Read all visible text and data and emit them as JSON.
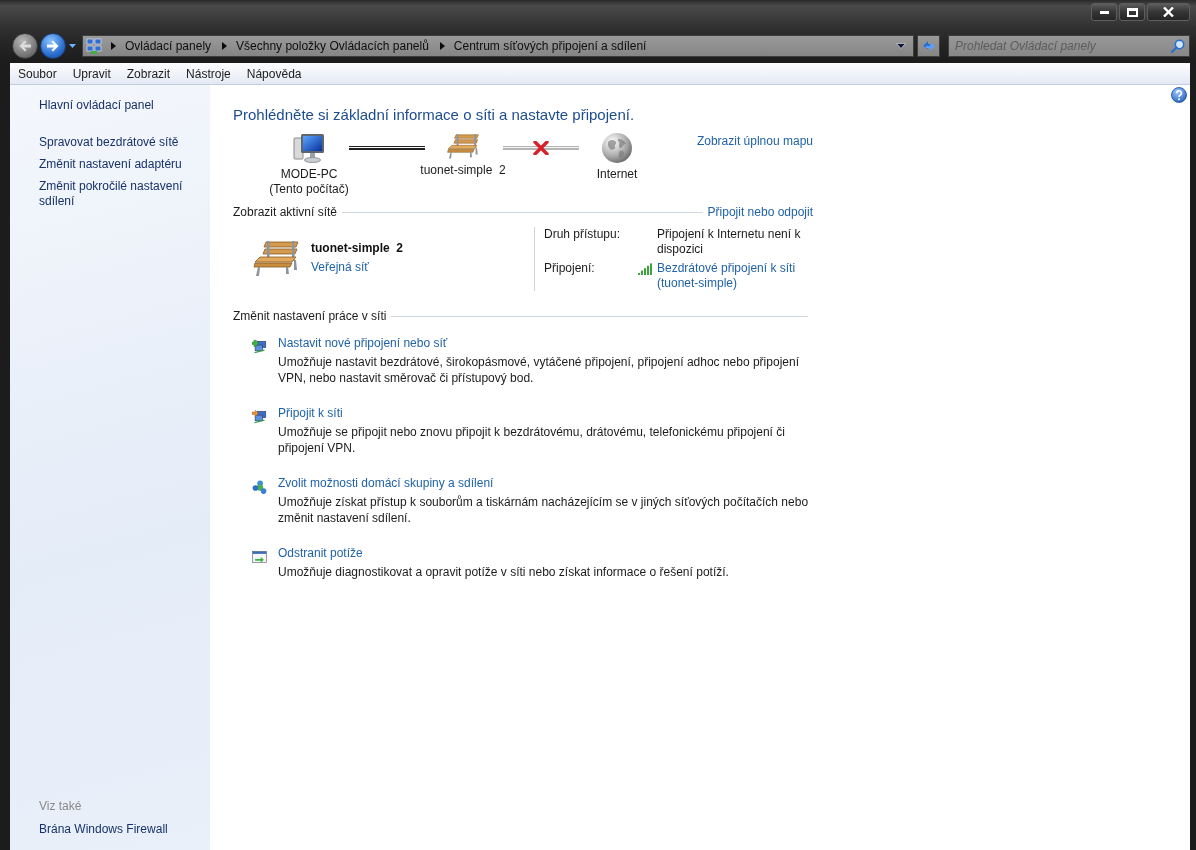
{
  "address_bar": {
    "path": [
      "Ovládací panely",
      "Všechny položky Ovládacích panelů",
      "Centrum síťových připojení a sdílení"
    ]
  },
  "search": {
    "placeholder": "Prohledat Ovládací panely"
  },
  "menu_bar": [
    "Soubor",
    "Upravit",
    "Zobrazit",
    "Nástroje",
    "Nápověda"
  ],
  "sidebar": {
    "home": "Hlavní ovládací panel",
    "tasks": [
      "Spravovat bezdrátové sítě",
      "Změnit nastavení adaptéru",
      "Změnit pokročilé nastavení sdílení"
    ],
    "see_also": {
      "heading": "Viz také",
      "items": [
        "Brána Windows Firewall"
      ]
    }
  },
  "main": {
    "title": "Prohlédněte si základní informace o síti a nastavte připojení.",
    "network_map": {
      "nodes": [
        {
          "kind": "computer",
          "label": "MODE-PC",
          "sublabel": "(Tento počítač)"
        },
        {
          "kind": "network",
          "label": "tuonet-simple  2"
        },
        {
          "kind": "internet",
          "label": "Internet"
        }
      ],
      "links": [
        {
          "connected": true
        },
        {
          "connected": false
        }
      ],
      "full_map_link": "Zobrazit úplnou mapu"
    },
    "active_networks": {
      "heading": "Zobrazit aktivní sítě",
      "action": "Připojit nebo odpojit",
      "networks": [
        {
          "name": "tuonet-simple  2",
          "category": "Veřejná síť",
          "properties": [
            {
              "kind": "text",
              "label": "Druh přístupu:",
              "value": "Připojení k Internetu není k dispozici"
            },
            {
              "kind": "connection",
              "label": "Připojení:",
              "value": "Bezdrátové připojení k síti (tuonet-simple)"
            }
          ]
        }
      ]
    },
    "tasks": {
      "heading": "Změnit nastavení práce v síti",
      "items": [
        {
          "kind": "new_connection",
          "title": "Nastavit nové připojení nebo síť",
          "description": "Umožňuje nastavit bezdrátové, širokopásmové, vytáčené připojení, připojení adhoc nebo připojení VPN, nebo nastavit směrovač či přístupový bod."
        },
        {
          "kind": "connect",
          "title": "Připojit k síti",
          "description": "Umožňuje se připojit nebo znovu připojit k bezdrátovému, drátovému, telefonickému připojení či připojení VPN."
        },
        {
          "kind": "homegroup",
          "title": "Zvolit možnosti domácí skupiny a sdílení",
          "description": "Umožňuje získat přístup k souborům a tiskárnám nacházejícím se v jiných síťových počítačích nebo změnit nastavení sdílení."
        },
        {
          "kind": "troubleshoot",
          "title": "Odstranit potíže",
          "description": "Umožňuje diagnostikovat a opravit potíže v síti nebo získat informace o řešení potíží."
        }
      ]
    }
  }
}
